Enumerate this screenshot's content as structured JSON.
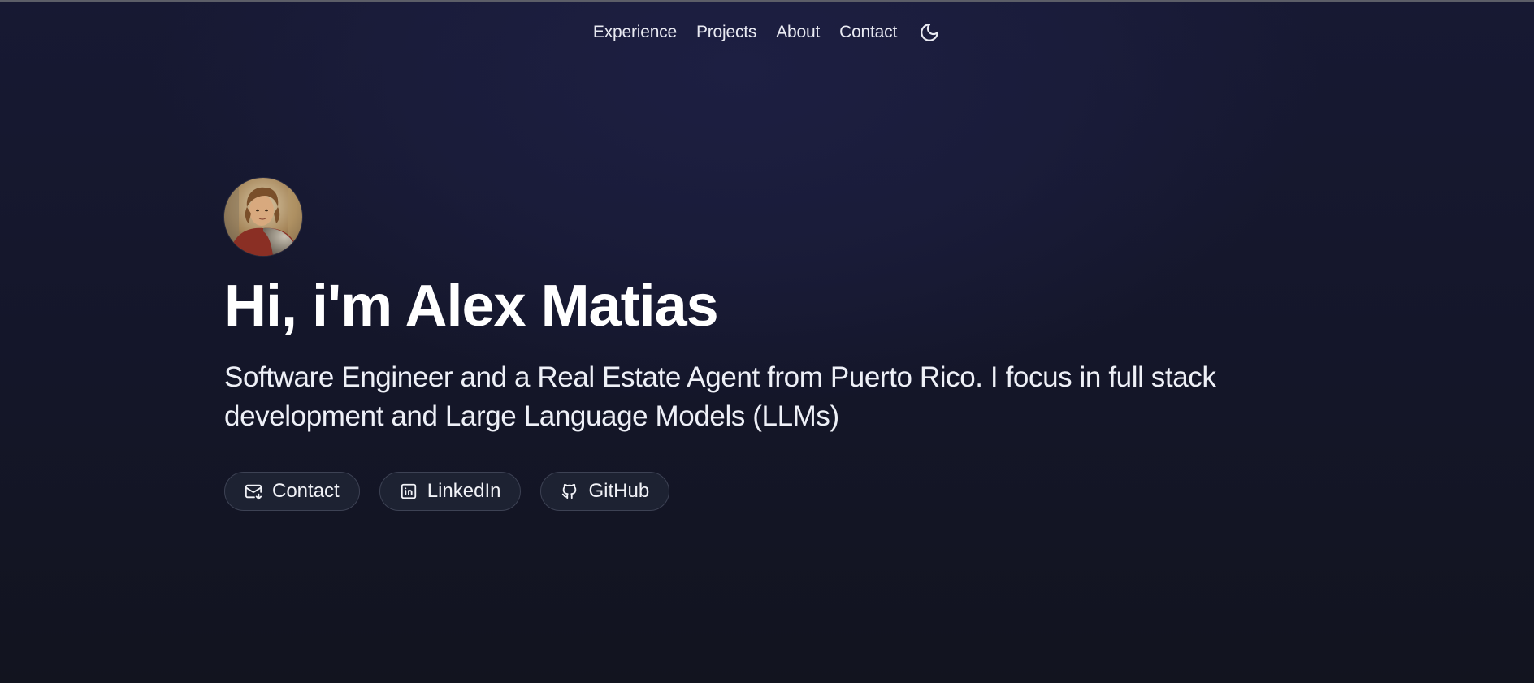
{
  "nav": {
    "items": [
      {
        "label": "Experience"
      },
      {
        "label": "Projects"
      },
      {
        "label": "About"
      },
      {
        "label": "Contact"
      }
    ],
    "theme_toggle_icon": "moon-icon"
  },
  "hero": {
    "avatar_icon": "avatar-portrait",
    "title": "Hi, i'm Alex Matias",
    "subtitle": "Software Engineer and a Real Estate Agent from Puerto Rico. I focus in full stack development and Large Language Models (LLMs)",
    "buttons": [
      {
        "label": "Contact",
        "icon": "mail-icon"
      },
      {
        "label": "LinkedIn",
        "icon": "linkedin-icon"
      },
      {
        "label": "GitHub",
        "icon": "github-icon"
      }
    ]
  },
  "colors": {
    "background": "#151731",
    "button_bg": "#1d2232",
    "button_border": "#3d4254",
    "text": "#ffffff"
  }
}
